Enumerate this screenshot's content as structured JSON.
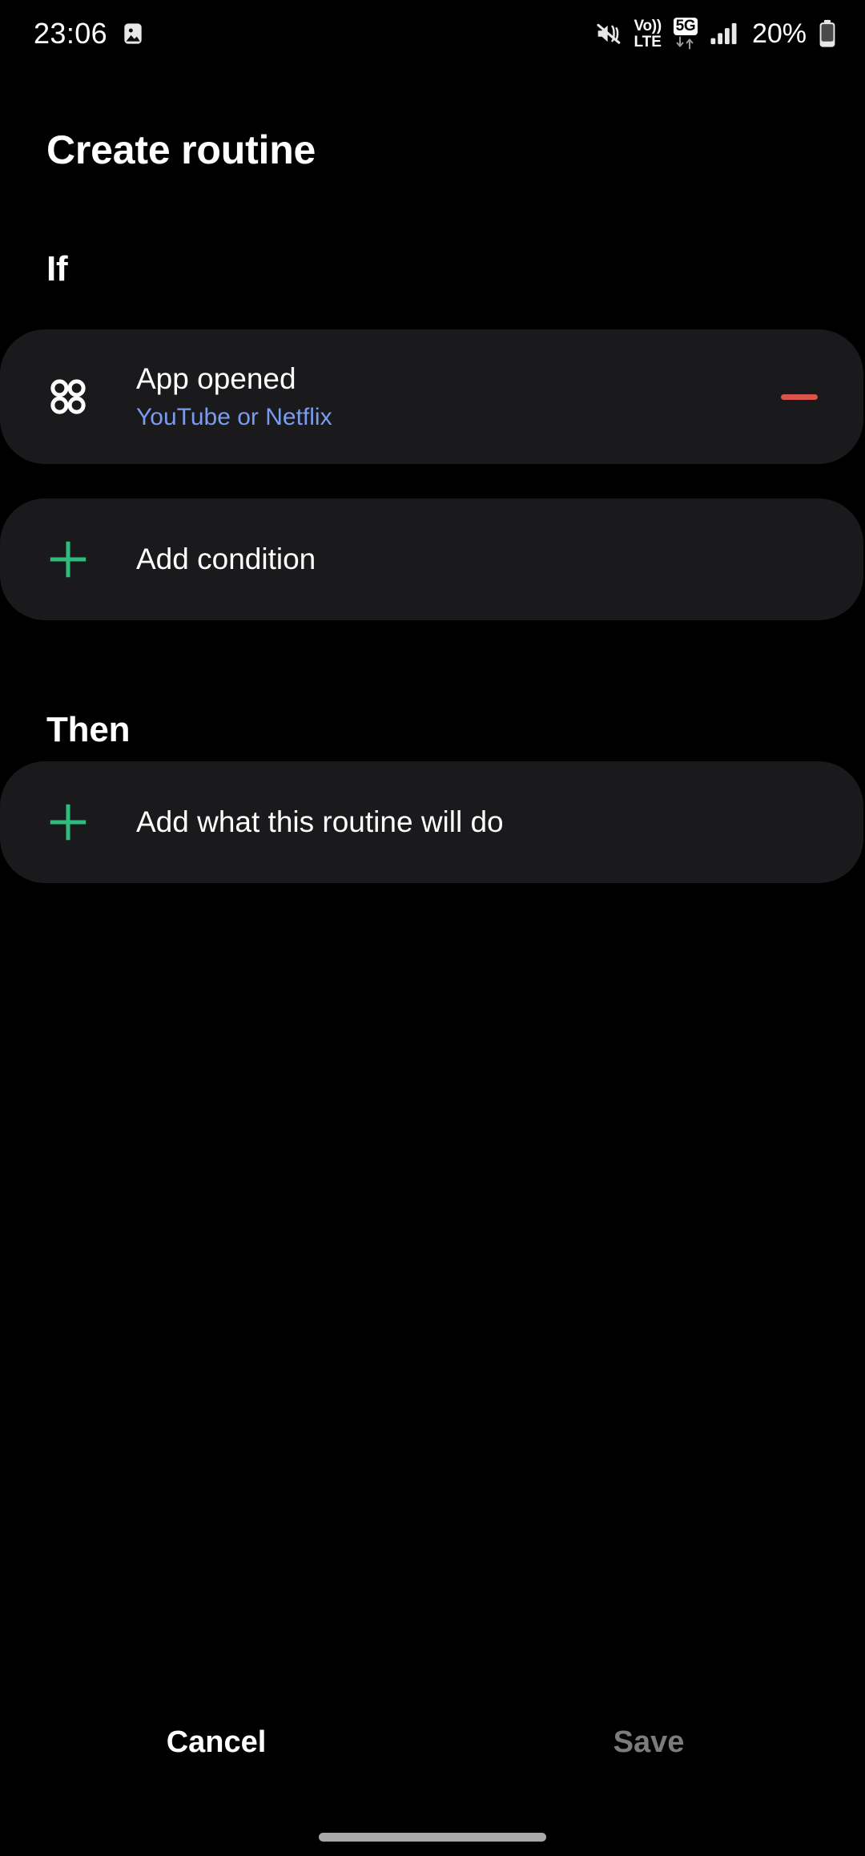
{
  "status_bar": {
    "time": "23:06",
    "left_icons": [
      "gallery-image-icon"
    ],
    "right_icons": [
      "mute-vibrate-icon",
      "volte-icon",
      "5g-data-icon",
      "signal-bars-icon",
      "battery-icon"
    ],
    "volte_top": "Vo))",
    "volte_bottom": "LTE",
    "network_badge": "5G",
    "battery_percent": "20%"
  },
  "header": {
    "title": "Create routine"
  },
  "sections": {
    "if": {
      "heading": "If",
      "condition": {
        "icon": "four-dots-grid-icon",
        "title": "App opened",
        "subtitle": "YouTube or Netflix",
        "remove_icon": "minus-icon"
      },
      "add_label": "Add condition",
      "add_icon": "plus-icon"
    },
    "then": {
      "heading": "Then",
      "add_label": "Add what this routine will do",
      "add_icon": "plus-icon"
    }
  },
  "footer": {
    "cancel_label": "Cancel",
    "save_label": "Save"
  },
  "colors": {
    "background": "#000000",
    "card": "#1a1a1c",
    "accent_green": "#2ebd7e",
    "accent_blue": "#7a9cf0",
    "accent_red": "#d9534f",
    "disabled_text": "#7c7c7c"
  }
}
